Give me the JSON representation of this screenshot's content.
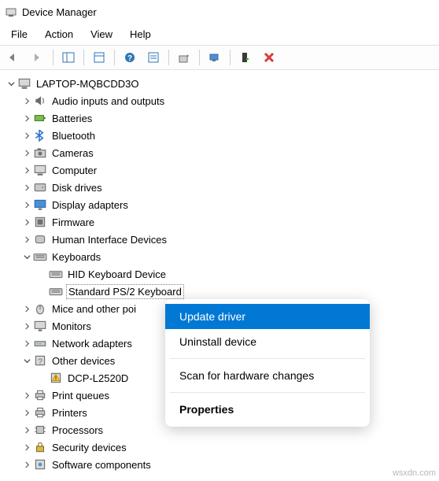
{
  "title": "Device Manager",
  "menubar": {
    "file": "File",
    "action": "Action",
    "view": "View",
    "help": "Help"
  },
  "tree": {
    "root": "LAPTOP-MQBCDD3O",
    "items": [
      {
        "label": "Audio inputs and outputs",
        "icon": "speaker"
      },
      {
        "label": "Batteries",
        "icon": "battery"
      },
      {
        "label": "Bluetooth",
        "icon": "bluetooth"
      },
      {
        "label": "Cameras",
        "icon": "camera"
      },
      {
        "label": "Computer",
        "icon": "computer"
      },
      {
        "label": "Disk drives",
        "icon": "disk"
      },
      {
        "label": "Display adapters",
        "icon": "display"
      },
      {
        "label": "Firmware",
        "icon": "firmware"
      },
      {
        "label": "Human Interface Devices",
        "icon": "hid"
      },
      {
        "label": "Keyboards",
        "icon": "keyboard",
        "expanded": true,
        "children": [
          {
            "label": "HID Keyboard Device",
            "icon": "keyboard"
          },
          {
            "label": "Standard PS/2 Keyboard",
            "icon": "keyboard",
            "selected": true
          }
        ]
      },
      {
        "label": "Mice and other poi",
        "icon": "mouse"
      },
      {
        "label": "Monitors",
        "icon": "monitor"
      },
      {
        "label": "Network adapters",
        "icon": "network"
      },
      {
        "label": "Other devices",
        "icon": "other",
        "expanded": true,
        "children": [
          {
            "label": "DCP-L2520D",
            "icon": "warn"
          }
        ]
      },
      {
        "label": "Print queues",
        "icon": "printer"
      },
      {
        "label": "Printers",
        "icon": "printer"
      },
      {
        "label": "Processors",
        "icon": "cpu"
      },
      {
        "label": "Security devices",
        "icon": "security"
      },
      {
        "label": "Software components",
        "icon": "software"
      }
    ]
  },
  "context_menu": {
    "update": "Update driver",
    "uninstall": "Uninstall device",
    "scan": "Scan for hardware changes",
    "properties": "Properties"
  },
  "watermark": "wsxdn.com"
}
